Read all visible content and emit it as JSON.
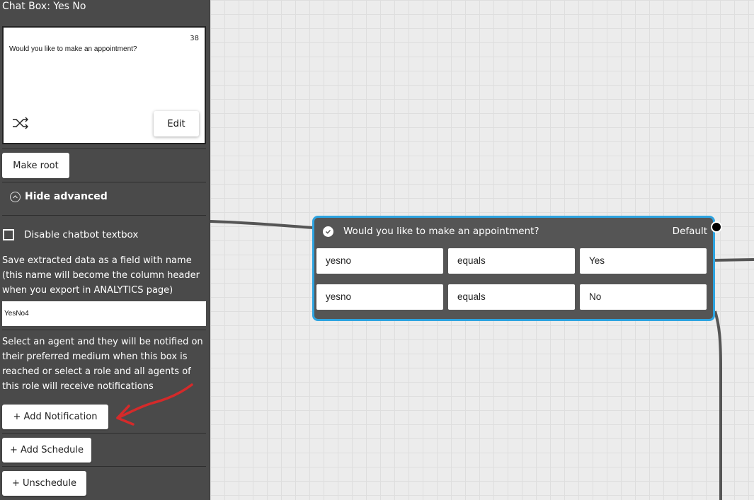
{
  "sidebar": {
    "title": "Chat Box: Yes No",
    "preview": {
      "char_count": "38",
      "message": "Would you like to make an appointment?",
      "shuffle_icon": "shuffle-icon",
      "edit_label": "Edit"
    },
    "make_root_label": "Make root",
    "hide_advanced_label": "Hide advanced",
    "disable_textbox_label": "Disable chatbot textbox",
    "disable_textbox_checked": false,
    "save_field_description": "Save extracted data as a field with name (this name will become the column header when you export in ANALYTICS page)",
    "save_field_value": "YesNo4",
    "notification_description": "Select an agent and they will be notified on their preferred medium when this box is reached or select a role and all agents of this role will receive notifications",
    "add_notification_label": "+ Add Notification",
    "add_schedule_label": "+ Add Schedule",
    "unschedule_label": "+ Unschedule"
  },
  "node": {
    "title": "Would you like to make an appointment?",
    "default_label": "Default",
    "conditions": [
      {
        "field": "yesno",
        "operator": "equals",
        "value": "Yes"
      },
      {
        "field": "yesno",
        "operator": "equals",
        "value": "No"
      }
    ]
  },
  "colors": {
    "sidebar_bg": "#4a4a4a",
    "node_border": "#2da3e0",
    "node_bg": "#555555",
    "annotation_arrow": "#d42a2a"
  }
}
